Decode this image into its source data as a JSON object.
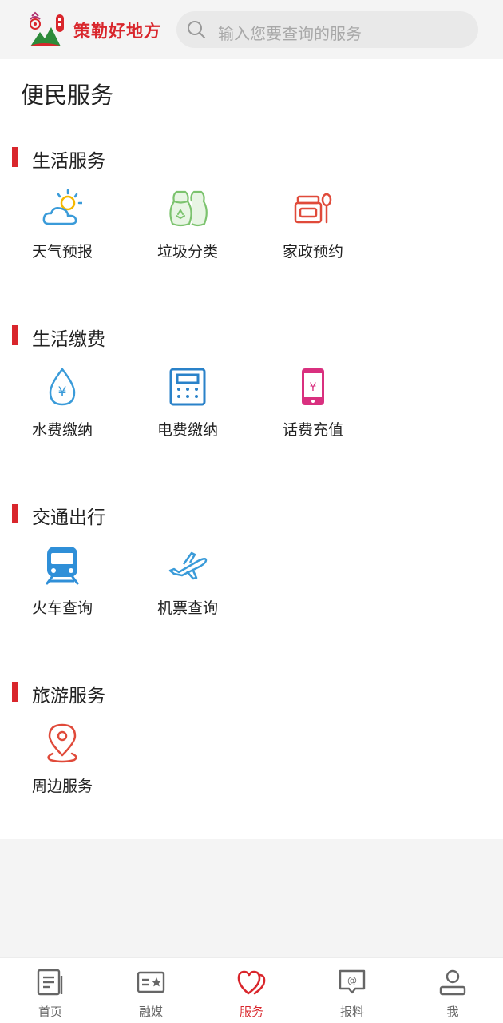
{
  "header": {
    "app_name": "策勒好地方",
    "search_placeholder": "输入您要查询的服务"
  },
  "page": {
    "title": "便民服务"
  },
  "sections": [
    {
      "title": "生活服务",
      "items": [
        {
          "label": "天气预报",
          "icon": "weather-icon"
        },
        {
          "label": "垃圾分类",
          "icon": "garbage-sorting-icon"
        },
        {
          "label": "家政预约",
          "icon": "housekeeping-icon"
        }
      ]
    },
    {
      "title": "生活缴费",
      "items": [
        {
          "label": "水费缴纳",
          "icon": "water-bill-icon"
        },
        {
          "label": "电费缴纳",
          "icon": "electricity-bill-icon"
        },
        {
          "label": "话费充值",
          "icon": "phone-recharge-icon"
        }
      ]
    },
    {
      "title": "交通出行",
      "items": [
        {
          "label": "火车查询",
          "icon": "train-icon"
        },
        {
          "label": "机票查询",
          "icon": "airplane-icon"
        }
      ]
    },
    {
      "title": "旅游服务",
      "items": [
        {
          "label": "周边服务",
          "icon": "location-pin-icon"
        }
      ]
    }
  ],
  "tabbar": {
    "items": [
      {
        "label": "首页",
        "icon": "home-document-icon",
        "active": false
      },
      {
        "label": "融媒",
        "icon": "media-card-icon",
        "active": false
      },
      {
        "label": "服务",
        "icon": "hearts-icon",
        "active": true
      },
      {
        "label": "报料",
        "icon": "report-chat-icon",
        "active": false
      },
      {
        "label": "我",
        "icon": "user-icon",
        "active": false
      }
    ]
  },
  "colors": {
    "brand_red": "#d9262c",
    "weather_blue": "#3a9bd9",
    "sun_yellow": "#f5b800",
    "garbage_green": "#7cc36e",
    "housekeeping_red": "#e04a3a",
    "water_blue": "#3a9bd9",
    "electric_blue": "#2a82c9",
    "phone_pink": "#d9307f",
    "train_blue": "#2f8fd8",
    "plane_blue": "#3a9bd9",
    "pin_red": "#e04a3a"
  }
}
